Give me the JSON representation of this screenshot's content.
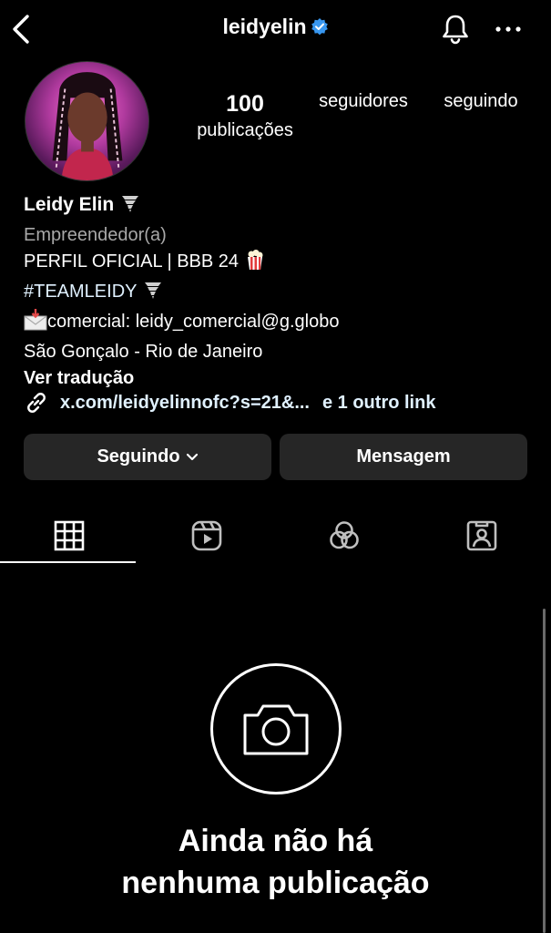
{
  "header": {
    "username": "leidyelin",
    "verified": true,
    "icons": {
      "back": "back-arrow-icon",
      "bell": "bell-icon",
      "more": "more-icon",
      "verified": "verified-badge-icon"
    }
  },
  "stats": {
    "posts": {
      "count": "100",
      "label": "publicações"
    },
    "followers": {
      "label": "seguidores"
    },
    "following": {
      "label": "seguindo"
    }
  },
  "bio": {
    "name": "Leidy Elin",
    "category": "Empreendedor(a)",
    "line1": "PERFIL OFICIAL | BBB 24",
    "hashtag": "#TEAMLEIDY",
    "contact": "comercial: leidy_comercial@g.globo",
    "location": "São Gonçalo - Rio de Janeiro",
    "translate": "Ver tradução"
  },
  "links": {
    "primary": "x.com/leidyelinnofc?s=21&...",
    "other": "e 1 outro link"
  },
  "actions": {
    "following_label": "Seguindo",
    "message_label": "Mensagem"
  },
  "tabs": [
    {
      "name": "grid",
      "icon": "grid-icon",
      "active": true
    },
    {
      "name": "reels",
      "icon": "reels-icon",
      "active": false
    },
    {
      "name": "collabs",
      "icon": "collab-icon",
      "active": false
    },
    {
      "name": "tagged",
      "icon": "tagged-icon",
      "active": false
    }
  ],
  "empty_state": {
    "line1": "Ainda não há",
    "line2": "nenhuma publicação",
    "icon": "camera-icon"
  },
  "colors": {
    "background": "#000000",
    "button": "#262626",
    "secondary_text": "#a8a8a8",
    "link_text": "#e0f1ff",
    "verified": "#3897f0"
  }
}
